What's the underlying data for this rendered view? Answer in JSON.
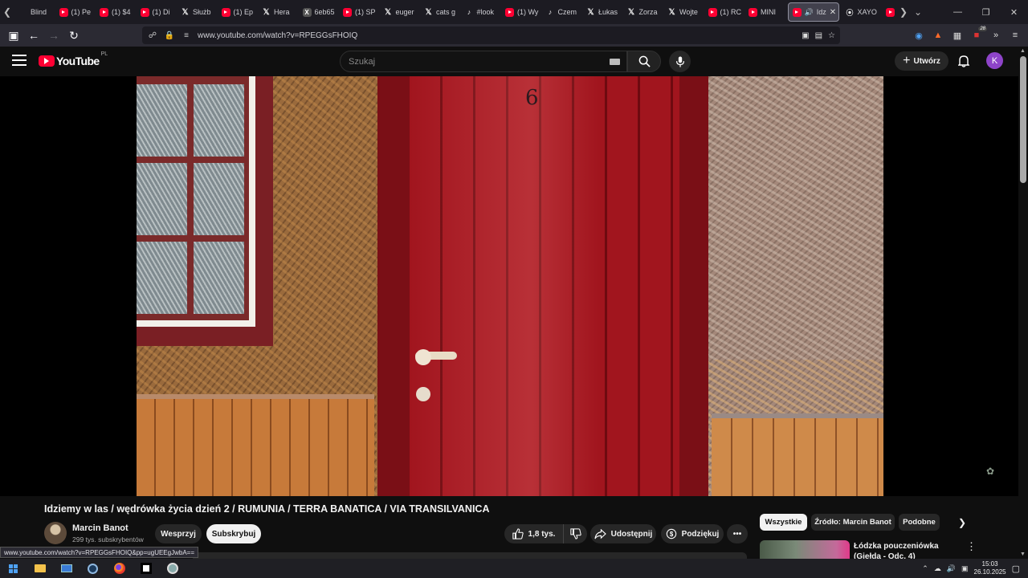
{
  "browser": {
    "tabs": [
      {
        "label": "Blind",
        "icon": "plain"
      },
      {
        "label": "(1) Pe",
        "icon": "youtube"
      },
      {
        "label": "(1) $4",
        "icon": "youtube"
      },
      {
        "label": "(1) Di",
        "icon": "youtube"
      },
      {
        "label": "Służb",
        "icon": "x"
      },
      {
        "label": "(1) Ep",
        "icon": "youtube"
      },
      {
        "label": "Hera",
        "icon": "x"
      },
      {
        "label": "6eb65",
        "icon": "x-box"
      },
      {
        "label": "(1) SP",
        "icon": "youtube"
      },
      {
        "label": "euger",
        "icon": "x"
      },
      {
        "label": "cats g",
        "icon": "x"
      },
      {
        "label": "#look",
        "icon": "tiktok"
      },
      {
        "label": "(1) Wy",
        "icon": "youtube"
      },
      {
        "label": "Czem",
        "icon": "tiktok"
      },
      {
        "label": "Łukas",
        "icon": "x"
      },
      {
        "label": "Zorza",
        "icon": "x"
      },
      {
        "label": "Wojte",
        "icon": "x"
      },
      {
        "label": "(1) RC",
        "icon": "youtube"
      },
      {
        "label": "MINI",
        "icon": "youtube"
      }
    ],
    "active_tab": {
      "label": "Idz",
      "icon": "youtube"
    },
    "after_tabs": [
      {
        "label": "XAYO",
        "icon": "play"
      }
    ],
    "url": "www.youtube.com/watch?v=RPEGGsFHOIQ",
    "ext_badge": "28",
    "status_link": "www.youtube.com/watch?v=RPEGGsFHOIQ&pp=ugUEEgJwbA=="
  },
  "youtube": {
    "logo": "YouTube",
    "region": "PL",
    "search_placeholder": "Szukaj",
    "create_label": "Utwórz",
    "avatar_letter": "K"
  },
  "video": {
    "door_number": "6",
    "title": "Idziemy w las / wędrówka życia dzień 2 / RUMUNIA / TERRA BANATICA / VIA TRANSILVANICA",
    "channel_name": "Marcin Banot",
    "channel_subs": "299 tys. subskrybentów",
    "support_label": "Wesprzyj",
    "subscribe_label": "Subskrybuj",
    "likes": "1,8 tys.",
    "share_label": "Udostępnij",
    "thanks_label": "Podziękuj"
  },
  "sidebar": {
    "chips": [
      "Wszystkie",
      "Źródło: Marcin Banot",
      "Podobne"
    ],
    "recommendation_title": "Łódzka pouczeniówka (Giełda - Odc. 4)"
  },
  "taskbar": {
    "time": "15:03",
    "date": "26.10.2025"
  },
  "colors": {
    "youtube_red": "#ff0033",
    "background": "#0f0f0f",
    "avatar": "#8e44c9"
  }
}
